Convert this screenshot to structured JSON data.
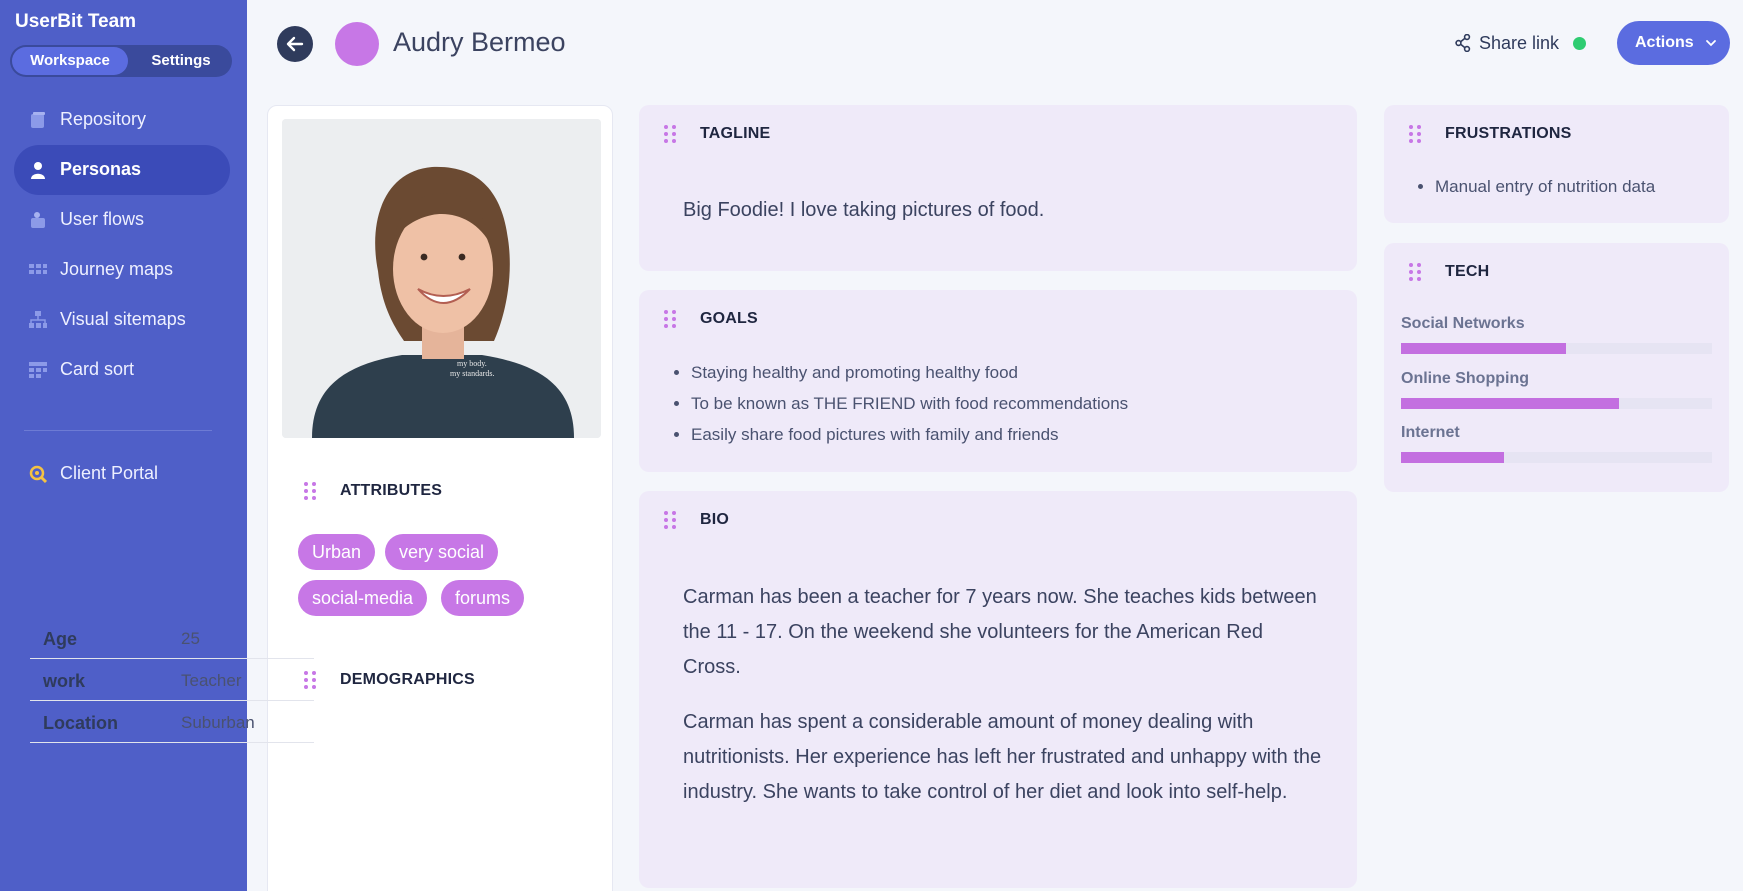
{
  "sidebar": {
    "team_name": "UserBit Team",
    "segments": {
      "workspace": "Workspace",
      "settings": "Settings"
    },
    "items": [
      {
        "label": "Repository",
        "icon": "repository-icon"
      },
      {
        "label": "Personas",
        "icon": "person-icon",
        "active": true
      },
      {
        "label": "User flows",
        "icon": "user-flows-icon"
      },
      {
        "label": "Journey maps",
        "icon": "journey-map-icon"
      },
      {
        "label": "Visual sitemaps",
        "icon": "sitemap-icon"
      },
      {
        "label": "Card sort",
        "icon": "card-sort-icon"
      }
    ],
    "client_portal": {
      "label": "Client Portal",
      "icon": "client-portal-icon"
    }
  },
  "header": {
    "persona_name": "Audry Bermeo",
    "share_label": "Share link",
    "actions_label": "Actions",
    "colors": {
      "accent": "#5b6ce0",
      "avatar": "#c777e6",
      "status": "#2ecc71"
    }
  },
  "profile": {
    "attributes_title": "ATTRIBUTES",
    "tags": [
      "Urban",
      "very social",
      "social-media",
      "forums"
    ],
    "demographics_title": "DEMOGRAPHICS",
    "demographics": [
      {
        "key": "Age",
        "value": "25"
      },
      {
        "key": "work",
        "value": "Teacher"
      },
      {
        "key": "Location",
        "value": "Suburban"
      }
    ]
  },
  "tagline": {
    "title": "TAGLINE",
    "text": "Big Foodie! I love taking pictures of food."
  },
  "goals": {
    "title": "GOALS",
    "items": [
      "Staying healthy and promoting healthy food",
      "To be known as THE FRIEND with food recommendations",
      "Easily share food pictures with family and friends"
    ]
  },
  "bio": {
    "title": "BIO",
    "paragraphs": [
      "Carman has been a teacher for 7 years now. She teaches kids between the 11 - 17. On the weekend she volunteers for the American Red Cross.",
      "Carman has spent a considerable amount of money dealing with nutritionists. Her experience has left her frustrated and unhappy with the industry. She wants to take control of her diet and look into self-help."
    ]
  },
  "frustrations": {
    "title": "FRUSTRATIONS",
    "items": [
      "Manual entry of nutrition data"
    ]
  },
  "tech": {
    "title": "TECH",
    "items": [
      {
        "label": "Social Networks",
        "level": 0.53
      },
      {
        "label": "Online Shopping",
        "level": 0.7
      },
      {
        "label": "Internet",
        "level": 0.33
      }
    ]
  }
}
